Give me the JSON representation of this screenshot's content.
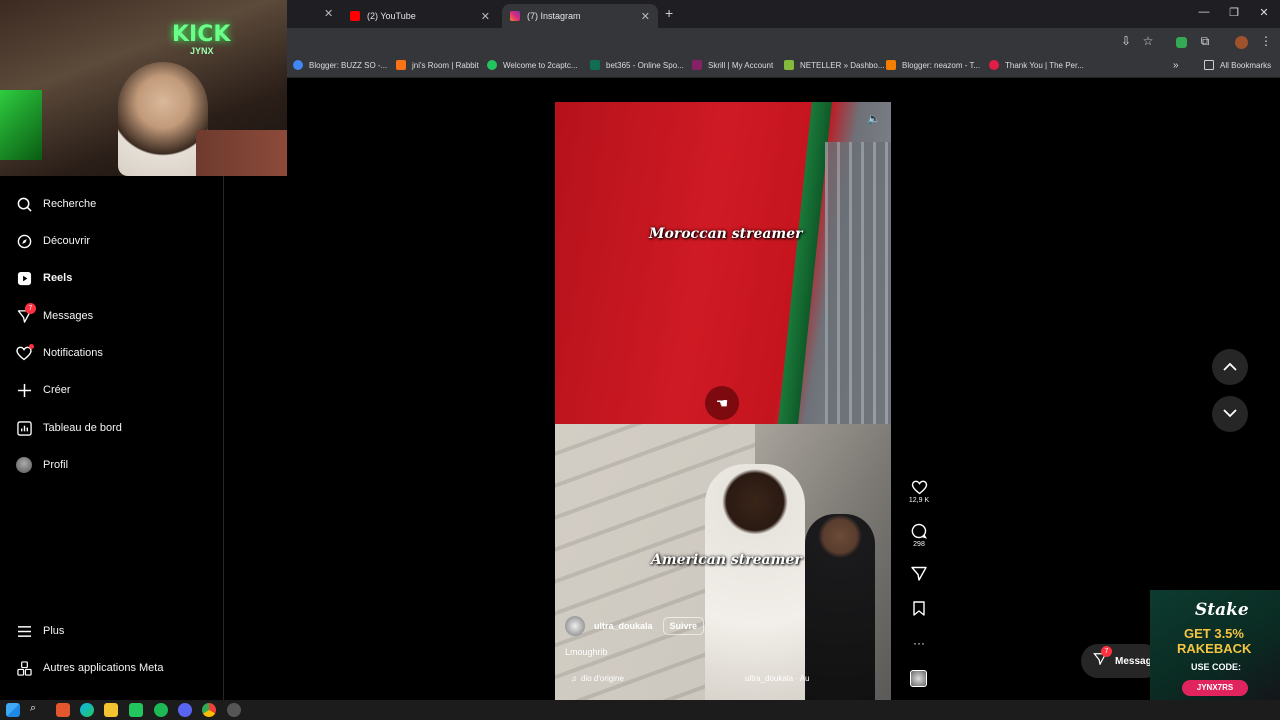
{
  "browser": {
    "tabs": [
      {
        "label": "(2) YouTube",
        "color": "#ff0000"
      },
      {
        "label": "(7) Instagram",
        "color": "#e1306c"
      }
    ],
    "bookmarks": [
      {
        "label": "Blogger: BUZZ SO -...",
        "color": "#4285f4"
      },
      {
        "label": "jni's Room | Rabbit",
        "color": "#f97316"
      },
      {
        "label": "Welcome to 2captc...",
        "color": "#22c55e"
      },
      {
        "label": "bet365 - Online Spo...",
        "color": "#126e51"
      },
      {
        "label": "Skrill | My Account",
        "color": "#862165"
      },
      {
        "label": "NETELLER » Dashbo...",
        "color": "#83ba3b"
      },
      {
        "label": "Blogger: neazom - T...",
        "color": "#f57d00"
      },
      {
        "label": "Thank You | The Per...",
        "color": "#e11d48"
      }
    ],
    "all_bookmarks": "All Bookmarks"
  },
  "webcam": {
    "sign_text": "KICK",
    "sign_sub": "JYNX"
  },
  "sidebar": {
    "items": [
      {
        "label": "Recherche",
        "icon": "search-icon"
      },
      {
        "label": "Découvrir",
        "icon": "compass-icon"
      },
      {
        "label": "Reels",
        "icon": "reels-icon"
      },
      {
        "label": "Messages",
        "icon": "messenger-icon",
        "badge": "7"
      },
      {
        "label": "Notifications",
        "icon": "heart-icon"
      },
      {
        "label": "Créer",
        "icon": "plus-icon"
      },
      {
        "label": "Tableau de bord",
        "icon": "dashboard-icon"
      },
      {
        "label": "Profil",
        "icon": "avatar"
      }
    ],
    "bottom": [
      {
        "label": "Plus",
        "icon": "menu-icon"
      },
      {
        "label": "Autres applications Meta",
        "icon": "meta-apps-icon"
      }
    ]
  },
  "reel": {
    "top_caption": "Moroccan streamer",
    "bottom_caption": "American streamer",
    "username": "ultra_doukala",
    "follow_label": "Suivre",
    "description": "Lmoughrib",
    "audio_left": "dio d'origine",
    "audio_right": "ultra_doukala · Au",
    "likes": "12,9 K",
    "comments": "298"
  },
  "messages_pill": {
    "label": "Messag",
    "badge": "7"
  },
  "stake_ad": {
    "logo": "Stake",
    "line1": "GET 3.5%",
    "line2": "RAKEBACK",
    "line3": "USE CODE:",
    "code": "JYNX7RS"
  },
  "colors": {
    "accent_red": "#ff3040",
    "sidebar_bg": "#000000",
    "panel": "#262626"
  }
}
